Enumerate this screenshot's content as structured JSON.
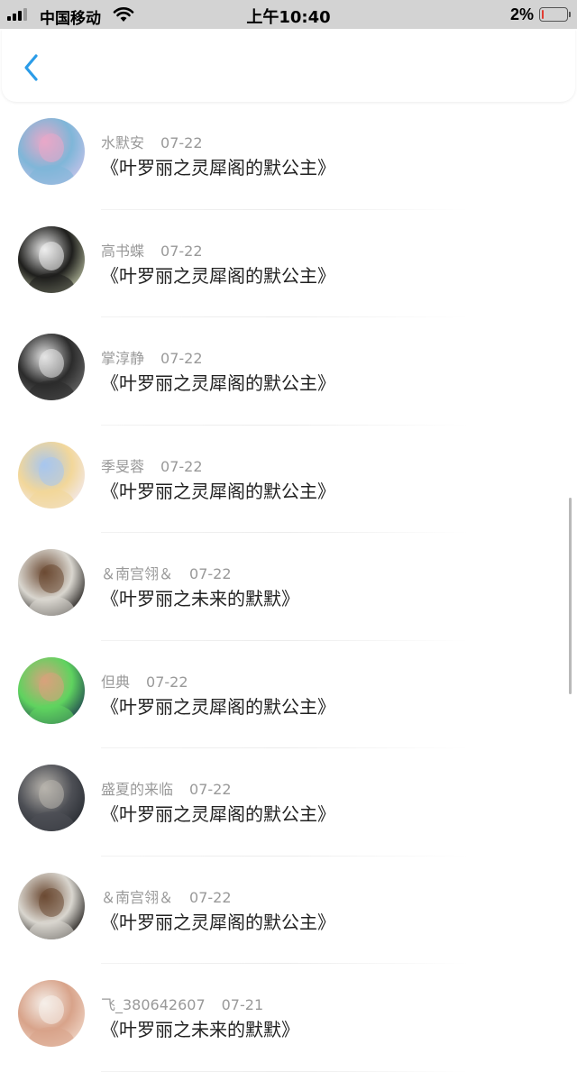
{
  "status_bar": {
    "carrier": "中国移动",
    "time": "上午10:40",
    "battery": "2%",
    "battery_level": 0.02,
    "battery_color": "#e23c32"
  },
  "nav": {
    "back_icon": "chevron-left-icon",
    "accent": "#2b9ce8"
  },
  "items": [
    {
      "user": "水默安",
      "date": "07-22",
      "title": "《叶罗丽之灵犀阁的默公主》",
      "avatar_colors": [
        "#c9c3ea",
        "#7fb6d8",
        "#e9a8c8"
      ]
    },
    {
      "user": "高书蝶",
      "date": "07-22",
      "title": "《叶罗丽之灵犀阁的默公主》",
      "avatar_colors": [
        "#bcc2a3",
        "#1e1e1c",
        "#eeeeee"
      ]
    },
    {
      "user": "掌淳静",
      "date": "07-22",
      "title": "《叶罗丽之灵犀阁的默公主》",
      "avatar_colors": [
        "#6a6a6a",
        "#2b2b2b",
        "#e5e5e5"
      ]
    },
    {
      "user": "季旻蓉",
      "date": "07-22",
      "title": "《叶罗丽之灵犀阁的默公主》",
      "avatar_colors": [
        "#f3eaf2",
        "#f2d79a",
        "#a8c6ee"
      ]
    },
    {
      "user": "＆南宫翎＆",
      "date": "07-22",
      "title": "《叶罗丽之未来的默默》",
      "avatar_colors": [
        "#14110f",
        "#d9d6cf",
        "#6c4a33"
      ]
    },
    {
      "user": "但典",
      "date": "07-22",
      "title": "《叶罗丽之灵犀阁的默公主》",
      "avatar_colors": [
        "#1b3a4f",
        "#5fd35f",
        "#d8a27c"
      ]
    },
    {
      "user": "盛夏的来临",
      "date": "07-22",
      "title": "《叶罗丽之灵犀阁的默公主》",
      "avatar_colors": [
        "#262a30",
        "#4d4f55",
        "#b8b4ad"
      ]
    },
    {
      "user": "＆南宫翎＆",
      "date": "07-22",
      "title": "《叶罗丽之灵犀阁的默公主》",
      "avatar_colors": [
        "#14110f",
        "#d9d6cf",
        "#6c4a33"
      ]
    },
    {
      "user": "飞_380642607",
      "date": "07-21",
      "title": "《叶罗丽之未来的默默》",
      "avatar_colors": [
        "#f0d7c8",
        "#d8a38a",
        "#f5efe9"
      ]
    }
  ]
}
